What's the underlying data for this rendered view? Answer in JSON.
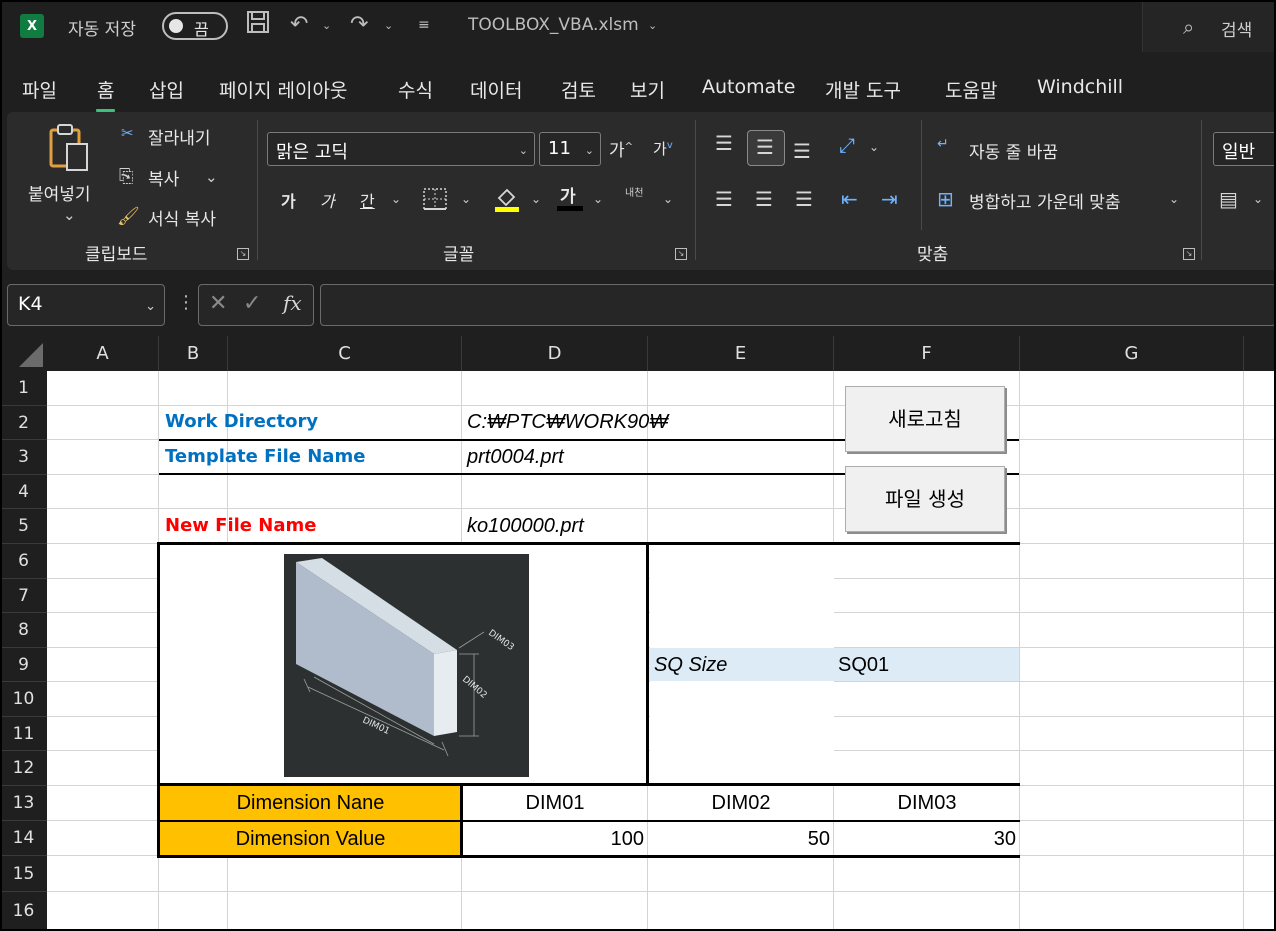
{
  "titlebar": {
    "app_icon": "X",
    "autosave_label": "자동 저장",
    "autosave_state": "끔",
    "filename": "TOOLBOX_VBA.xlsm",
    "search_label": "검색"
  },
  "menu": {
    "tabs": [
      "파일",
      "홈",
      "삽입",
      "페이지 레이아웃",
      "수식",
      "데이터",
      "검토",
      "보기",
      "Automate",
      "개발 도구",
      "도움말",
      "Windchill"
    ],
    "active_tab": "홈"
  },
  "ribbon": {
    "clipboard": {
      "paste": "붙여넣기",
      "cut": "잘라내기",
      "copy": "복사",
      "format_painter": "서식 복사",
      "label": "클립보드"
    },
    "font": {
      "font_name": "맑은 고딕",
      "font_size": "11",
      "grow": "가",
      "shrink": "가",
      "bold": "가",
      "italic": "가",
      "underline": "간",
      "font_color": "가",
      "phonetic": "내천",
      "label": "글꼴"
    },
    "alignment": {
      "wrap_text": "자동 줄 바꿈",
      "merge_center": "병합하고 가운데 맞춤",
      "label": "맞춤"
    },
    "number": {
      "format": "일반"
    }
  },
  "formula": {
    "name_box": "K4",
    "fx": "fx",
    "value": ""
  },
  "grid": {
    "columns": [
      "A",
      "B",
      "C",
      "D",
      "E",
      "F",
      "G"
    ],
    "rows": [
      "1",
      "2",
      "3",
      "4",
      "5",
      "6",
      "7",
      "8",
      "9",
      "10",
      "11",
      "12",
      "13",
      "14",
      "15",
      "16"
    ],
    "work_directory_label": "Work Directory",
    "work_directory_value": "C:₩PTC₩WORK90₩",
    "template_label": "Template File Name",
    "template_value": "prt0004.prt",
    "new_file_label": "New File Name",
    "new_file_value": "ko100000.prt",
    "sq_size_label": "SQ Size",
    "sq_size_value": "SQ01",
    "dim_name_label": "Dimension Nane",
    "dim_value_label": "Dimension Value",
    "dim_names": [
      "DIM01",
      "DIM02",
      "DIM03"
    ],
    "dim_values": [
      "100",
      "50",
      "30"
    ],
    "refresh_button": "새로고침",
    "create_button": "파일 생성",
    "image_labels": [
      "DIM01",
      "DIM02",
      "DIM03"
    ]
  }
}
